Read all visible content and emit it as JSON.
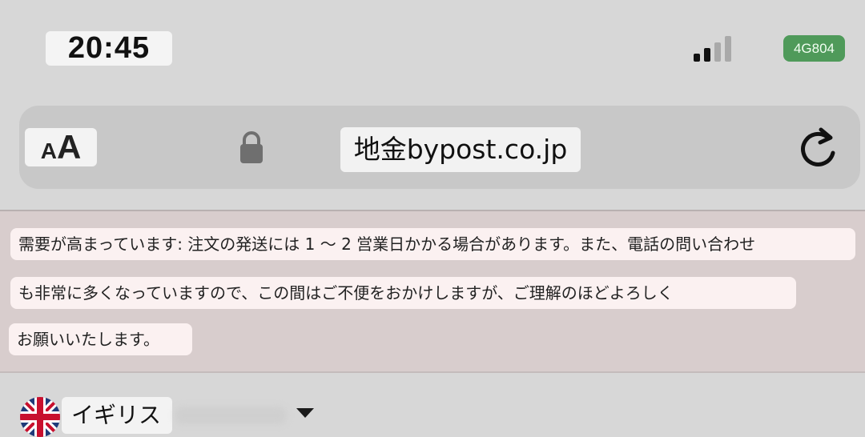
{
  "status_bar": {
    "time": "20:45",
    "network_badge": "4G804",
    "signal_icon": "cellular-signal-icon"
  },
  "browser": {
    "text_size_button": {
      "small": "A",
      "large": "A"
    },
    "lock_icon": "lock-icon",
    "url": "地金bypost.co.jp",
    "reload_icon": "reload-icon"
  },
  "notice": {
    "lines": [
      "需要が高まっています: 注文の発送には 1 〜 2 営業日かかる場合があります。また、電話の問い合わせ",
      "も非常に多くなっていますので、この間はご不便をおかけしますが、ご理解のほどよろしく",
      "お願いいたします。"
    ]
  },
  "country_selector": {
    "flag_icon": "uk-flag-icon",
    "country": "イギリス",
    "caret_icon": "dropdown-caret-icon"
  },
  "colors": {
    "notice_background": "#d8cdcd",
    "network_badge": "#4f9a5a"
  }
}
